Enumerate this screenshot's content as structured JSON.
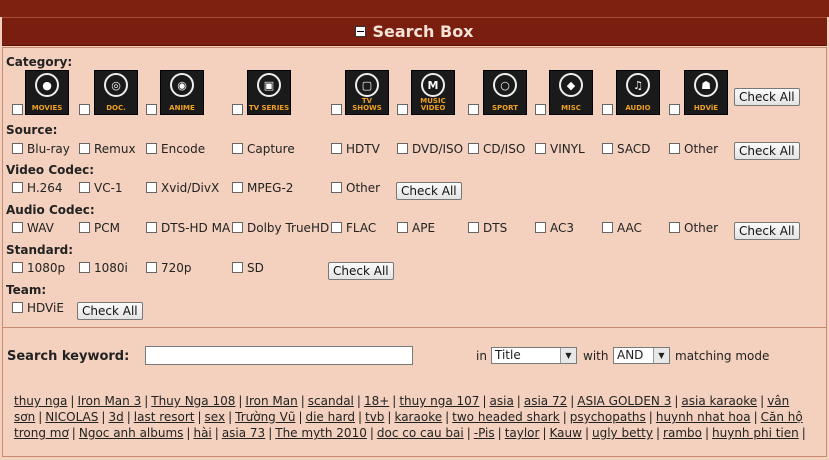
{
  "header": {
    "title": "Search Box"
  },
  "category": {
    "label": "Category:",
    "items": [
      {
        "name": "MOVIES"
      },
      {
        "name": "DOC."
      },
      {
        "name": "ANIME"
      },
      {
        "name": "TV SERIES",
        "brand": "cinemax"
      },
      {
        "name": "TV SHOWS",
        "brand": "TV"
      },
      {
        "name": "MUSIC VIDEO",
        "brand": "MTV"
      },
      {
        "name": "SPORT",
        "brand": "OLYMPIC"
      },
      {
        "name": "MISC"
      },
      {
        "name": "AUDIO"
      },
      {
        "name": "HDViE"
      }
    ],
    "check_all": "Check All"
  },
  "source": {
    "label": "Source:",
    "options": [
      "Blu-ray",
      "Remux",
      "Encode",
      "Capture",
      "HDTV",
      "DVD/ISO",
      "CD/ISO",
      "VINYL",
      "SACD",
      "Other"
    ],
    "check_all": "Check All"
  },
  "video_codec": {
    "label": "Video Codec:",
    "options": [
      "H.264",
      "VC-1",
      "Xvid/DivX",
      "MPEG-2",
      "Other"
    ],
    "check_all": "Check All"
  },
  "audio_codec": {
    "label": "Audio Codec:",
    "options": [
      "WAV",
      "PCM",
      "DTS-HD MA",
      "Dolby TrueHD",
      "FLAC",
      "APE",
      "DTS",
      "AC3",
      "AAC",
      "Other"
    ],
    "check_all": "Check All"
  },
  "standard": {
    "label": "Standard:",
    "options": [
      "1080p",
      "1080i",
      "720p",
      "SD"
    ],
    "check_all": "Check All"
  },
  "team": {
    "label": "Team:",
    "options": [
      "HDViE"
    ],
    "check_all": "Check All"
  },
  "search": {
    "label": "Search keyword:",
    "value": "",
    "in_label": "in",
    "in_value": "Title",
    "with_label": "with",
    "with_value": "AND",
    "mode_label": "matching mode"
  },
  "tags": [
    "thuy nga",
    "Iron Man 3",
    "Thuy Nga 108",
    "Iron Man",
    "scandal",
    "18+",
    "thuy nga 107",
    "asia",
    "asia 72",
    "ASIA GOLDEN 3",
    "asia karaoke",
    "vân sơn",
    "NICOLAS",
    "3d",
    "last resort",
    "sex",
    "Trường Vũ",
    "die hard",
    "tvb",
    "karaoke",
    "two headed shark",
    "psychopaths",
    "huynh nhat hoa",
    "Căn hộ trong mơ",
    "Ngoc anh albums",
    "hài",
    "asia 73",
    "The myth 2010",
    "doc co cau bai",
    "-Pis",
    "taylor",
    "Kauw",
    "ugly betty",
    "rambo",
    "huynh phi tien"
  ],
  "colors": {
    "header_bg": "#7a1f0f",
    "page_bg": "#f3d1be",
    "header_text": "#f6e2d6",
    "icon_caption": "#f0a020"
  }
}
